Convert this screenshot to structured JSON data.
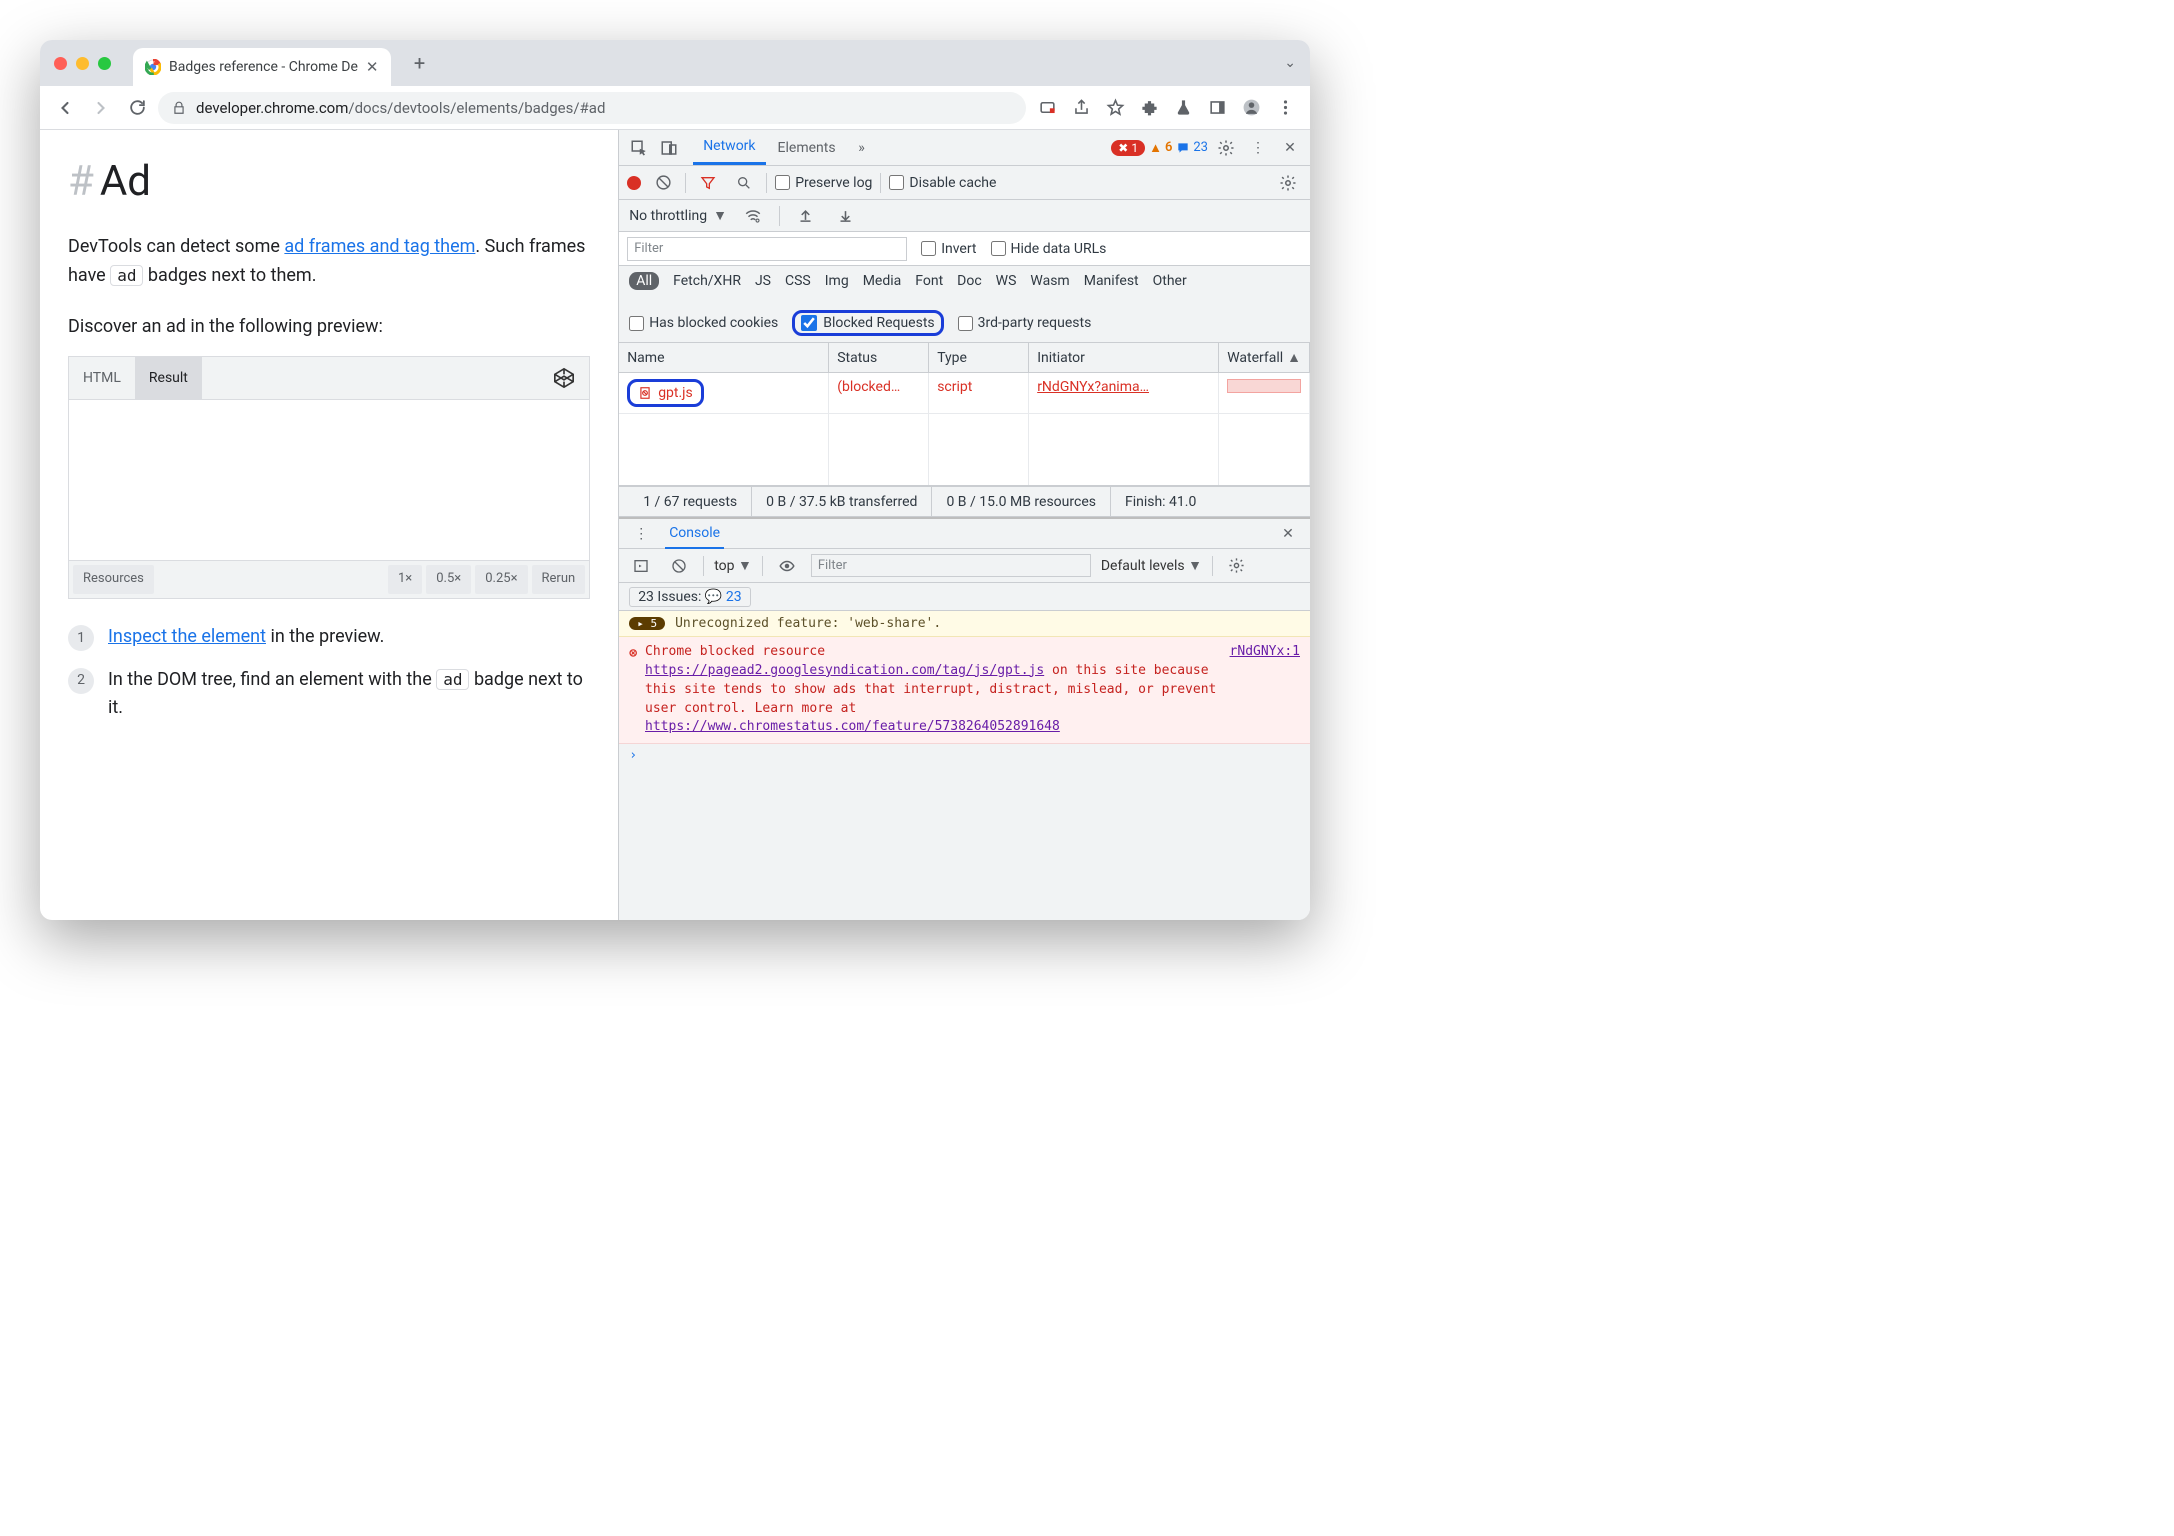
{
  "browser": {
    "tab_title": "Badges reference - Chrome De",
    "url_domain": "developer.chrome.com",
    "url_path": "/docs/devtools/elements/badges/#ad"
  },
  "page": {
    "heading": "Ad",
    "p1_prefix": "DevTools can detect some ",
    "p1_link": "ad frames and tag them",
    "p1_suffix1": ". Such frames have ",
    "p1_badge": "ad",
    "p1_suffix2": " badges next to them.",
    "p2": "Discover an ad in the following preview:",
    "preview_tabs": {
      "html": "HTML",
      "result": "Result"
    },
    "preview_footer": {
      "resources": "Resources",
      "z1": "1×",
      "z05": "0.5×",
      "z025": "0.25×",
      "rerun": "Rerun"
    },
    "step1_link": "Inspect the element",
    "step1_suffix": " in the preview.",
    "step2_prefix": "In the DOM tree, find an element with the ",
    "step2_badge": "ad",
    "step2_suffix": " badge next to it."
  },
  "devtools": {
    "tabs": {
      "network": "Network",
      "elements": "Elements"
    },
    "counts": {
      "errors": "1",
      "warnings": "6",
      "messages": "23"
    },
    "toolbar": {
      "preserve": "Preserve log",
      "disable_cache": "Disable cache",
      "throttling": "No throttling"
    },
    "filter": {
      "placeholder": "Filter",
      "invert": "Invert",
      "hide_urls": "Hide data URLs"
    },
    "chips": {
      "all": "All",
      "fetch": "Fetch/XHR",
      "js": "JS",
      "css": "CSS",
      "img": "Img",
      "media": "Media",
      "font": "Font",
      "doc": "Doc",
      "ws": "WS",
      "wasm": "Wasm",
      "manifest": "Manifest",
      "other": "Other",
      "blocked_cookies": "Has blocked cookies",
      "blocked_requests": "Blocked Requests",
      "third_party": "3rd-party requests"
    },
    "table": {
      "headers": {
        "name": "Name",
        "status": "Status",
        "type": "Type",
        "initiator": "Initiator",
        "waterfall": "Waterfall"
      },
      "row": {
        "name": "gpt.js",
        "status": "(blocked…",
        "type": "script",
        "initiator": "rNdGNYx?anima…"
      }
    },
    "summary": {
      "requests": "1 / 67 requests",
      "transferred": "0 B / 37.5 kB transferred",
      "resources": "0 B / 15.0 MB resources",
      "finish": "Finish: 41.0"
    },
    "console": {
      "tab": "Console",
      "context": "top",
      "filter_placeholder": "Filter",
      "levels": "Default levels",
      "issues_label": "23 Issues:",
      "issues_count": "23",
      "warn_count": "5",
      "warn_text": "Unrecognized feature: 'web-share'.",
      "err_prefix": "Chrome blocked resource ",
      "err_url1": "https://pagead2.googlesyndication.com/tag/js/gpt.js",
      "err_mid": " on this site because this site tends to show ads that interrupt, distract, mislead, or prevent user control. Learn more at ",
      "err_url2": "https://www.chromestatus.com/feature/5738264052891648",
      "err_source": "rNdGNYx:1",
      "prompt": "›"
    }
  }
}
